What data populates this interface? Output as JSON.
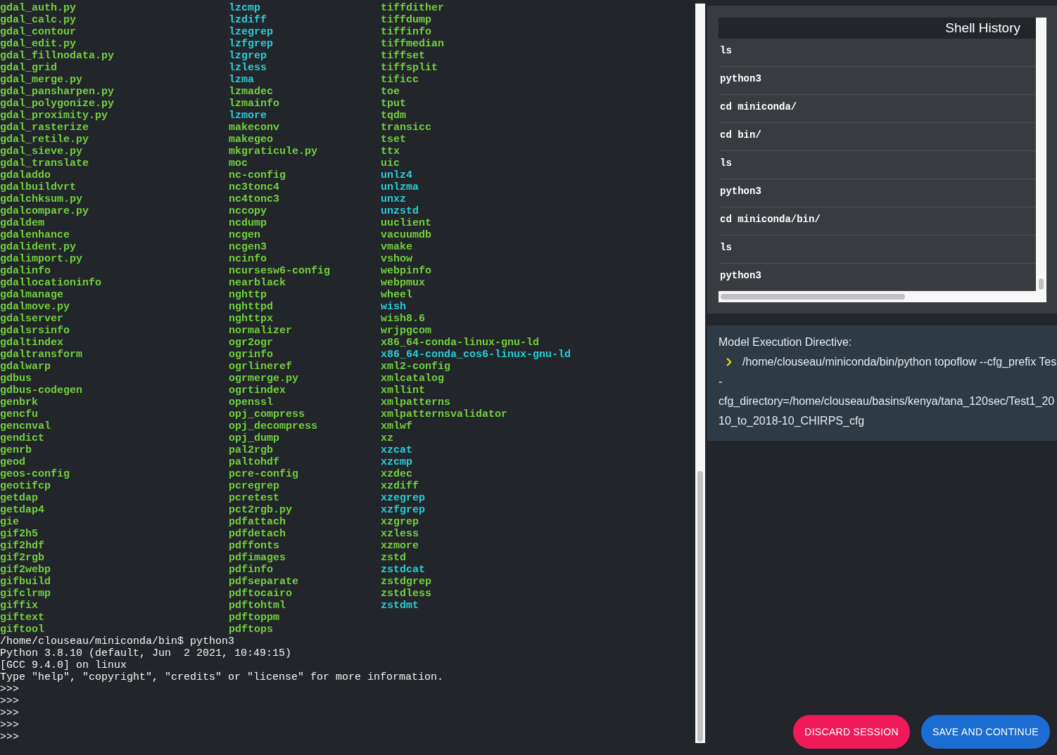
{
  "terminal": {
    "listing": [
      [
        {
          "name": "gdal_auth.py",
          "kind": "file"
        },
        {
          "name": "gdal_calc.py",
          "kind": "file"
        },
        {
          "name": "gdal_contour",
          "kind": "file"
        },
        {
          "name": "gdal_edit.py",
          "kind": "file"
        },
        {
          "name": "gdal_fillnodata.py",
          "kind": "file"
        },
        {
          "name": "gdal_grid",
          "kind": "file"
        },
        {
          "name": "gdal_merge.py",
          "kind": "file"
        },
        {
          "name": "gdal_pansharpen.py",
          "kind": "file"
        },
        {
          "name": "gdal_polygonize.py",
          "kind": "file"
        },
        {
          "name": "gdal_proximity.py",
          "kind": "file"
        },
        {
          "name": "gdal_rasterize",
          "kind": "file"
        },
        {
          "name": "gdal_retile.py",
          "kind": "file"
        },
        {
          "name": "gdal_sieve.py",
          "kind": "file"
        },
        {
          "name": "gdal_translate",
          "kind": "file"
        },
        {
          "name": "gdaladdo",
          "kind": "file"
        },
        {
          "name": "gdalbuildvrt",
          "kind": "file"
        },
        {
          "name": "gdalchksum.py",
          "kind": "file"
        },
        {
          "name": "gdalcompare.py",
          "kind": "file"
        },
        {
          "name": "gdaldem",
          "kind": "file"
        },
        {
          "name": "gdalenhance",
          "kind": "file"
        },
        {
          "name": "gdalident.py",
          "kind": "file"
        },
        {
          "name": "gdalimport.py",
          "kind": "file"
        },
        {
          "name": "gdalinfo",
          "kind": "file"
        },
        {
          "name": "gdallocationinfo",
          "kind": "file"
        },
        {
          "name": "gdalmanage",
          "kind": "file"
        },
        {
          "name": "gdalmove.py",
          "kind": "file"
        },
        {
          "name": "gdalserver",
          "kind": "file"
        },
        {
          "name": "gdalsrsinfo",
          "kind": "file"
        },
        {
          "name": "gdaltindex",
          "kind": "file"
        },
        {
          "name": "gdaltransform",
          "kind": "file"
        },
        {
          "name": "gdalwarp",
          "kind": "file"
        },
        {
          "name": "gdbus",
          "kind": "file"
        },
        {
          "name": "gdbus-codegen",
          "kind": "file"
        },
        {
          "name": "genbrk",
          "kind": "file"
        },
        {
          "name": "gencfu",
          "kind": "file"
        },
        {
          "name": "gencnval",
          "kind": "file"
        },
        {
          "name": "gendict",
          "kind": "file"
        },
        {
          "name": "genrb",
          "kind": "file"
        },
        {
          "name": "geod",
          "kind": "file"
        },
        {
          "name": "geos-config",
          "kind": "file"
        },
        {
          "name": "geotifcp",
          "kind": "file"
        },
        {
          "name": "getdap",
          "kind": "file"
        },
        {
          "name": "getdap4",
          "kind": "file"
        },
        {
          "name": "gie",
          "kind": "file"
        },
        {
          "name": "gif2h5",
          "kind": "file"
        },
        {
          "name": "gif2hdf",
          "kind": "file"
        },
        {
          "name": "gif2rgb",
          "kind": "file"
        },
        {
          "name": "gif2webp",
          "kind": "file"
        },
        {
          "name": "gifbuild",
          "kind": "file"
        },
        {
          "name": "gifclrmp",
          "kind": "file"
        },
        {
          "name": "giffix",
          "kind": "file"
        },
        {
          "name": "giftext",
          "kind": "file"
        },
        {
          "name": "giftool",
          "kind": "file"
        }
      ],
      [
        {
          "name": "lzcmp",
          "kind": "link"
        },
        {
          "name": "lzdiff",
          "kind": "link"
        },
        {
          "name": "lzegrep",
          "kind": "link"
        },
        {
          "name": "lzfgrep",
          "kind": "link"
        },
        {
          "name": "lzgrep",
          "kind": "link"
        },
        {
          "name": "lzless",
          "kind": "link"
        },
        {
          "name": "lzma",
          "kind": "link"
        },
        {
          "name": "lzmadec",
          "kind": "file"
        },
        {
          "name": "lzmainfo",
          "kind": "file"
        },
        {
          "name": "lzmore",
          "kind": "link"
        },
        {
          "name": "makeconv",
          "kind": "file"
        },
        {
          "name": "makegeo",
          "kind": "file"
        },
        {
          "name": "mkgraticule.py",
          "kind": "file"
        },
        {
          "name": "moc",
          "kind": "file"
        },
        {
          "name": "nc-config",
          "kind": "file"
        },
        {
          "name": "nc3tonc4",
          "kind": "file"
        },
        {
          "name": "nc4tonc3",
          "kind": "file"
        },
        {
          "name": "nccopy",
          "kind": "file"
        },
        {
          "name": "ncdump",
          "kind": "file"
        },
        {
          "name": "ncgen",
          "kind": "file"
        },
        {
          "name": "ncgen3",
          "kind": "file"
        },
        {
          "name": "ncinfo",
          "kind": "file"
        },
        {
          "name": "ncursesw6-config",
          "kind": "file"
        },
        {
          "name": "nearblack",
          "kind": "file"
        },
        {
          "name": "nghttp",
          "kind": "file"
        },
        {
          "name": "nghttpd",
          "kind": "file"
        },
        {
          "name": "nghttpx",
          "kind": "file"
        },
        {
          "name": "normalizer",
          "kind": "file"
        },
        {
          "name": "ogr2ogr",
          "kind": "file"
        },
        {
          "name": "ogrinfo",
          "kind": "file"
        },
        {
          "name": "ogrlineref",
          "kind": "file"
        },
        {
          "name": "ogrmerge.py",
          "kind": "file"
        },
        {
          "name": "ogrtindex",
          "kind": "file"
        },
        {
          "name": "openssl",
          "kind": "file"
        },
        {
          "name": "opj_compress",
          "kind": "file"
        },
        {
          "name": "opj_decompress",
          "kind": "file"
        },
        {
          "name": "opj_dump",
          "kind": "file"
        },
        {
          "name": "pal2rgb",
          "kind": "file"
        },
        {
          "name": "paltohdf",
          "kind": "file"
        },
        {
          "name": "pcre-config",
          "kind": "file"
        },
        {
          "name": "pcregrep",
          "kind": "file"
        },
        {
          "name": "pcretest",
          "kind": "file"
        },
        {
          "name": "pct2rgb.py",
          "kind": "file"
        },
        {
          "name": "pdfattach",
          "kind": "file"
        },
        {
          "name": "pdfdetach",
          "kind": "file"
        },
        {
          "name": "pdffonts",
          "kind": "file"
        },
        {
          "name": "pdfimages",
          "kind": "file"
        },
        {
          "name": "pdfinfo",
          "kind": "file"
        },
        {
          "name": "pdfseparate",
          "kind": "file"
        },
        {
          "name": "pdftocairo",
          "kind": "file"
        },
        {
          "name": "pdftohtml",
          "kind": "file"
        },
        {
          "name": "pdftoppm",
          "kind": "file"
        },
        {
          "name": "pdftops",
          "kind": "file"
        }
      ],
      [
        {
          "name": "tiffdither",
          "kind": "file"
        },
        {
          "name": "tiffdump",
          "kind": "file"
        },
        {
          "name": "tiffinfo",
          "kind": "file"
        },
        {
          "name": "tiffmedian",
          "kind": "file"
        },
        {
          "name": "tiffset",
          "kind": "file"
        },
        {
          "name": "tiffsplit",
          "kind": "file"
        },
        {
          "name": "tificc",
          "kind": "file"
        },
        {
          "name": "toe",
          "kind": "file"
        },
        {
          "name": "tput",
          "kind": "file"
        },
        {
          "name": "tqdm",
          "kind": "file"
        },
        {
          "name": "transicc",
          "kind": "file"
        },
        {
          "name": "tset",
          "kind": "file"
        },
        {
          "name": "ttx",
          "kind": "file"
        },
        {
          "name": "uic",
          "kind": "file"
        },
        {
          "name": "unlz4",
          "kind": "link"
        },
        {
          "name": "unlzma",
          "kind": "link"
        },
        {
          "name": "unxz",
          "kind": "link"
        },
        {
          "name": "unzstd",
          "kind": "link"
        },
        {
          "name": "uuclient",
          "kind": "file"
        },
        {
          "name": "vacuumdb",
          "kind": "file"
        },
        {
          "name": "vmake",
          "kind": "file"
        },
        {
          "name": "vshow",
          "kind": "file"
        },
        {
          "name": "webpinfo",
          "kind": "file"
        },
        {
          "name": "webpmux",
          "kind": "file"
        },
        {
          "name": "wheel",
          "kind": "file"
        },
        {
          "name": "wish",
          "kind": "link"
        },
        {
          "name": "wish8.6",
          "kind": "file"
        },
        {
          "name": "wrjpgcom",
          "kind": "file"
        },
        {
          "name": "x86_64-conda-linux-gnu-ld",
          "kind": "file"
        },
        {
          "name": "x86_64-conda_cos6-linux-gnu-ld",
          "kind": "link"
        },
        {
          "name": "xml2-config",
          "kind": "file"
        },
        {
          "name": "xmlcatalog",
          "kind": "file"
        },
        {
          "name": "xmllint",
          "kind": "file"
        },
        {
          "name": "xmlpatterns",
          "kind": "file"
        },
        {
          "name": "xmlpatternsvalidator",
          "kind": "file"
        },
        {
          "name": "xmlwf",
          "kind": "file"
        },
        {
          "name": "xz",
          "kind": "file"
        },
        {
          "name": "xzcat",
          "kind": "link"
        },
        {
          "name": "xzcmp",
          "kind": "link"
        },
        {
          "name": "xzdec",
          "kind": "file"
        },
        {
          "name": "xzdiff",
          "kind": "file"
        },
        {
          "name": "xzegrep",
          "kind": "link"
        },
        {
          "name": "xzfgrep",
          "kind": "link"
        },
        {
          "name": "xzgrep",
          "kind": "file"
        },
        {
          "name": "xzless",
          "kind": "file"
        },
        {
          "name": "xzmore",
          "kind": "file"
        },
        {
          "name": "zstd",
          "kind": "file"
        },
        {
          "name": "zstdcat",
          "kind": "link"
        },
        {
          "name": "zstdgrep",
          "kind": "file"
        },
        {
          "name": "zstdless",
          "kind": "file"
        },
        {
          "name": "zstdmt",
          "kind": "link"
        }
      ]
    ],
    "output": [
      "/home/clouseau/miniconda/bin$ python3",
      "Python 3.8.10 (default, Jun  2 2021, 10:49:15)",
      "[GCC 9.4.0] on linux",
      "Type \"help\", \"copyright\", \"credits\" or \"license\" for more information.",
      ">>>",
      ">>>",
      ">>>",
      ">>>",
      ">>>"
    ]
  },
  "shell_history": {
    "title": "Shell History",
    "items": [
      "ls",
      "python3",
      "cd miniconda/",
      "cd bin/",
      "ls",
      "python3",
      "cd miniconda/bin/",
      "ls",
      "python3"
    ]
  },
  "directive": {
    "title": "Model Execution Directive:",
    "command": "/home/clouseau/miniconda/bin/python topoflow --cfg_prefix Tes",
    "continuation": [
      "-",
      "cfg_directory=/home/clouseau/basins/kenya/tana_120sec/Test1_20",
      "10_to_2018-10_CHIRPS_cfg"
    ]
  },
  "buttons": [
    {
      "label": "DISCARD SESSION",
      "kind": "discard"
    },
    {
      "label": "SAVE AND CONTINUE",
      "kind": "save"
    }
  ]
}
